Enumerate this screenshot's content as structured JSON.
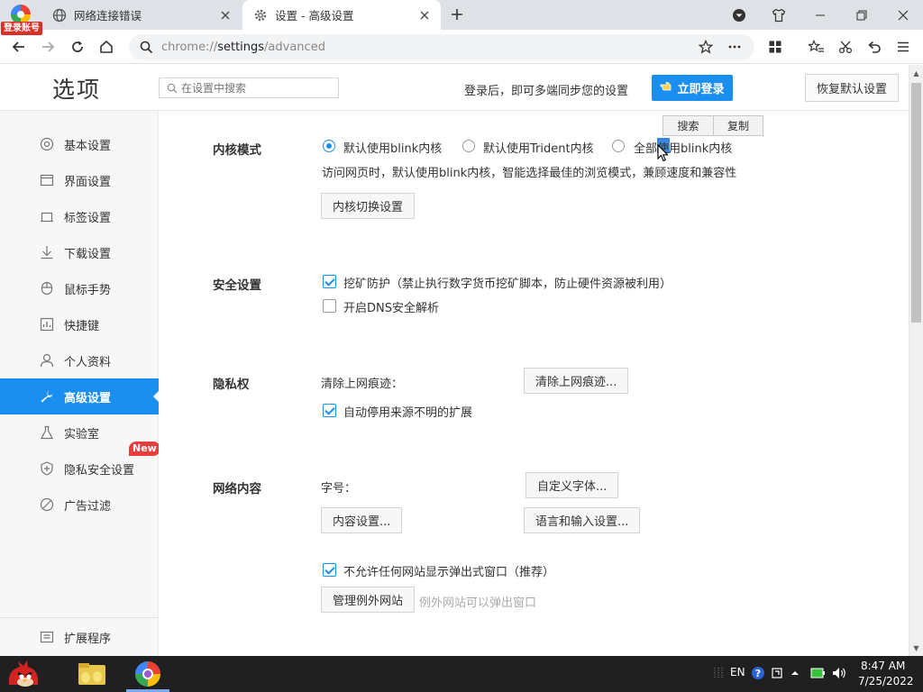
{
  "browser": {
    "login_badge": "登录账号",
    "tabs": [
      {
        "title": "网络连接错误",
        "icon": "globe-icon"
      },
      {
        "title": "设置 - 高级设置",
        "icon": "gear-icon"
      }
    ],
    "url_prefix": "chrome://",
    "url_host": "settings",
    "url_path": "/advanced"
  },
  "header": {
    "title": "选项",
    "search_placeholder": "在设置中搜索",
    "sync_text": "登录后，即可多端同步您的设置",
    "login_button": "立即登录",
    "reset_button": "恢复默认设置"
  },
  "sidebar": {
    "items": [
      {
        "label": "基本设置",
        "icon": "basic-settings-icon"
      },
      {
        "label": "界面设置",
        "icon": "interface-icon"
      },
      {
        "label": "标签设置",
        "icon": "tab-icon"
      },
      {
        "label": "下载设置",
        "icon": "download-icon"
      },
      {
        "label": "鼠标手势",
        "icon": "mouse-icon"
      },
      {
        "label": "快捷键",
        "icon": "shortcut-icon"
      },
      {
        "label": "个人资料",
        "icon": "person-icon"
      },
      {
        "label": "高级设置",
        "icon": "wrench-icon",
        "active": true
      },
      {
        "label": "实验室",
        "icon": "flask-icon"
      },
      {
        "label": "隐私安全设置",
        "icon": "shield-icon"
      },
      {
        "label": "广告过滤",
        "icon": "block-icon"
      }
    ],
    "new_badge": "New",
    "extensions": "扩展程序"
  },
  "kernel": {
    "title": "内核模式",
    "options": [
      "默认使用blink内核",
      "默认使用Trident内核",
      "全部使用blink内核"
    ],
    "selected": 0,
    "description": "访问网页时，默认使用blink内核，智能选择最佳的浏览模式，兼顾速度和兼容性",
    "switch_button": "内核切换设置"
  },
  "popup": {
    "search": "搜索",
    "copy": "复制"
  },
  "security": {
    "title": "安全设置",
    "mining": {
      "label": "挖矿防护（禁止执行数字货币挖矿脚本，防止硬件资源被利用）",
      "checked": true
    },
    "dns": {
      "label": "开启DNS安全解析",
      "checked": false
    }
  },
  "privacy": {
    "title": "隐私权",
    "clear_label": "清除上网痕迹：",
    "clear_button": "清除上网痕迹...",
    "auto_disable": {
      "label": "自动停用来源不明的扩展",
      "checked": true
    }
  },
  "network": {
    "title": "网络内容",
    "font_label": "字号：",
    "font_button": "自定义字体...",
    "content_button": "内容设置...",
    "lang_button": "语言和输入设置...",
    "popup_block": {
      "label": "不允许任何网站显示弹出式窗口（推荐）",
      "checked": true
    },
    "exceptions_button": "管理例外网站",
    "exceptions_hint": "例外网站可以弹出窗口"
  },
  "taskbar": {
    "lang": "EN",
    "time": "8:47 AM",
    "date": "7/25/2022"
  },
  "colors": {
    "accent": "#1a8ff0",
    "new_badge": "#ea3d3d",
    "taskbar": "#202020"
  }
}
